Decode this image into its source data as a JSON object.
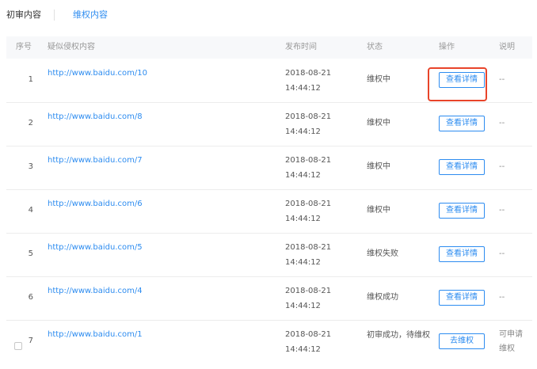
{
  "tabs": [
    "初审内容",
    "维权内容"
  ],
  "columns": [
    "序号",
    "疑似侵权内容",
    "发布时间",
    "状态",
    "操作",
    "说明"
  ],
  "rows": [
    {
      "idx": "1",
      "url": "http://www.baidu.com/10",
      "date": "2018-08-21",
      "time": "14:44:12",
      "status": "维权中",
      "action": "查看详情",
      "note": "--"
    },
    {
      "idx": "2",
      "url": "http://www.baidu.com/8",
      "date": "2018-08-21",
      "time": "14:44:12",
      "status": "维权中",
      "action": "查看详情",
      "note": "--"
    },
    {
      "idx": "3",
      "url": "http://www.baidu.com/7",
      "date": "2018-08-21",
      "time": "14:44:12",
      "status": "维权中",
      "action": "查看详情",
      "note": "--"
    },
    {
      "idx": "4",
      "url": "http://www.baidu.com/6",
      "date": "2018-08-21",
      "time": "14:44:12",
      "status": "维权中",
      "action": "查看详情",
      "note": "--"
    },
    {
      "idx": "5",
      "url": "http://www.baidu.com/5",
      "date": "2018-08-21",
      "time": "14:44:12",
      "status": "维权失败",
      "action": "查看详情",
      "note": "--"
    },
    {
      "idx": "6",
      "url": "http://www.baidu.com/4",
      "date": "2018-08-21",
      "time": "14:44:12",
      "status": "维权成功",
      "action": "查看详情",
      "note": "--"
    },
    {
      "idx": "7",
      "url": "http://www.baidu.com/1",
      "date": "2018-08-21",
      "time": "14:44:12",
      "status": "初审成功，待维权",
      "action": "去维权",
      "note": "可申请维权"
    }
  ],
  "colors": {
    "accent": "#2d8cf0",
    "highlight": "#e8442a"
  }
}
